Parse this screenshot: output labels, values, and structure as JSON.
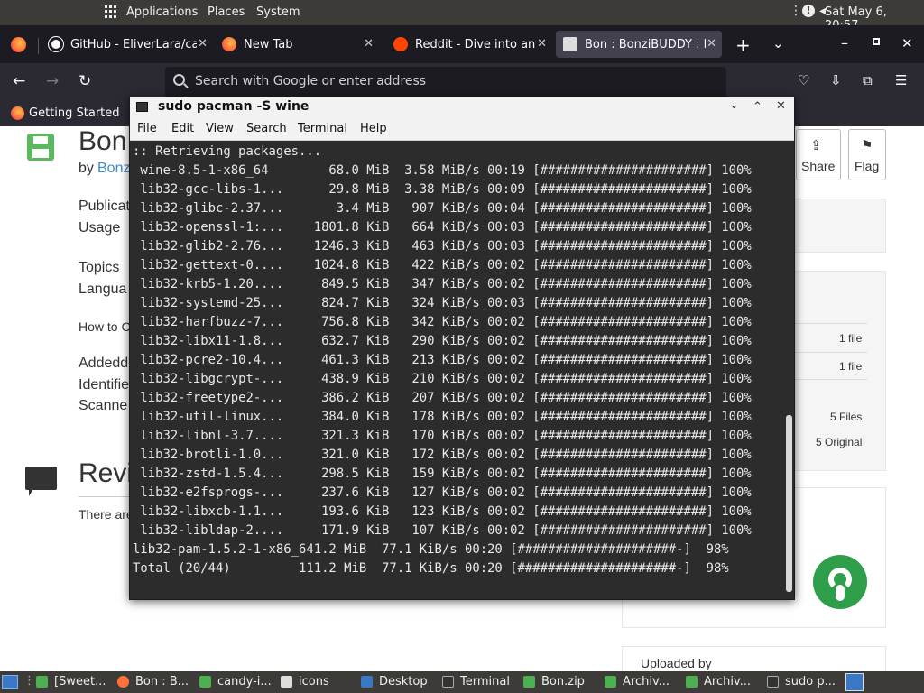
{
  "top_panel": {
    "applications": "Applications",
    "places": "Places",
    "system": "System",
    "clock": "Sat May 6, 20:57"
  },
  "tabs": [
    {
      "label": "GitHub - EliverLara/ca",
      "favicon": "github-icon",
      "color": "#ffffff"
    },
    {
      "label": "New Tab",
      "favicon": "firefox-icon",
      "color": "#ff7139"
    },
    {
      "label": "Reddit - Dive into any",
      "favicon": "reddit-icon",
      "color": "#ff4500"
    },
    {
      "label": "Bon : BonziBUDDY : F",
      "favicon": "archive-icon",
      "color": "#dddddd"
    }
  ],
  "urlbar": {
    "placeholder": "Search with Google or enter address"
  },
  "bookmarks": {
    "getting_started": "Getting Started"
  },
  "webpage": {
    "title": "Bon",
    "by": "by",
    "author": "Bonz",
    "publication": "Publicat",
    "usage": "Usage",
    "topics": "Topics",
    "language": "Langua",
    "howto": "How to C",
    "added": "Addedd",
    "identifier": "Identifie",
    "scanner": "Scanne",
    "reviews": "Revi",
    "there_are": "There are",
    "share": "Share",
    "flag": "Flag",
    "file1": "1 file",
    "file2": "1 file",
    "files5": "5 Files",
    "original5": "5 Original",
    "uploaded_by": "Uploaded by"
  },
  "terminal": {
    "title": "sudo pacman -S wine",
    "menu": [
      "File",
      "Edit",
      "View",
      "Search",
      "Terminal",
      "Help"
    ],
    "header": ":: Retrieving packages...",
    "rows": [
      [
        "wine-8.5-1-x86_64",
        "68.0 MiB",
        "3.58 MiB/s",
        "00:19",
        "[######################]",
        "100%"
      ],
      [
        "lib32-gcc-libs-1...",
        "29.8 MiB",
        "3.38 MiB/s",
        "00:09",
        "[######################]",
        "100%"
      ],
      [
        "lib32-glibc-2.37...",
        "3.4 MiB",
        "907 KiB/s",
        "00:04",
        "[######################]",
        "100%"
      ],
      [
        "lib32-openssl-1:...",
        "1801.8 KiB",
        "664 KiB/s",
        "00:03",
        "[######################]",
        "100%"
      ],
      [
        "lib32-glib2-2.76...",
        "1246.3 KiB",
        "463 KiB/s",
        "00:03",
        "[######################]",
        "100%"
      ],
      [
        "lib32-gettext-0....",
        "1024.8 KiB",
        "422 KiB/s",
        "00:02",
        "[######################]",
        "100%"
      ],
      [
        "lib32-krb5-1.20....",
        "849.5 KiB",
        "347 KiB/s",
        "00:02",
        "[######################]",
        "100%"
      ],
      [
        "lib32-systemd-25...",
        "824.7 KiB",
        "324 KiB/s",
        "00:03",
        "[######################]",
        "100%"
      ],
      [
        "lib32-harfbuzz-7...",
        "756.8 KiB",
        "342 KiB/s",
        "00:02",
        "[######################]",
        "100%"
      ],
      [
        "lib32-libx11-1.8...",
        "632.7 KiB",
        "290 KiB/s",
        "00:02",
        "[######################]",
        "100%"
      ],
      [
        "lib32-pcre2-10.4...",
        "461.3 KiB",
        "213 KiB/s",
        "00:02",
        "[######################]",
        "100%"
      ],
      [
        "lib32-libgcrypt-...",
        "438.9 KiB",
        "210 KiB/s",
        "00:02",
        "[######################]",
        "100%"
      ],
      [
        "lib32-freetype2-...",
        "386.2 KiB",
        "207 KiB/s",
        "00:02",
        "[######################]",
        "100%"
      ],
      [
        "lib32-util-linux...",
        "384.0 KiB",
        "178 KiB/s",
        "00:02",
        "[######################]",
        "100%"
      ],
      [
        "lib32-libnl-3.7....",
        "321.3 KiB",
        "170 KiB/s",
        "00:02",
        "[######################]",
        "100%"
      ],
      [
        "lib32-brotli-1.0...",
        "321.0 KiB",
        "172 KiB/s",
        "00:02",
        "[######################]",
        "100%"
      ],
      [
        "lib32-zstd-1.5.4...",
        "298.5 KiB",
        "159 KiB/s",
        "00:02",
        "[######################]",
        "100%"
      ],
      [
        "lib32-e2fsprogs-...",
        "237.6 KiB",
        "127 KiB/s",
        "00:02",
        "[######################]",
        "100%"
      ],
      [
        "lib32-libxcb-1.1...",
        "193.6 KiB",
        "123 KiB/s",
        "00:02",
        "[######################]",
        "100%"
      ],
      [
        "lib32-libldap-2....",
        "171.9 KiB",
        "107 KiB/s",
        "00:02",
        "[######################]",
        "100%"
      ]
    ],
    "pam_line": "lib32-pam-1.5.2-1-x86_641.2 MiB  77.1 KiB/s 00:20 [#####################-]  98%",
    "total_line": "Total (20/44)         111.2 MiB  77.1 KiB/s 00:20 [#####################-]  98%"
  },
  "taskbar": [
    {
      "label": "[Sweet...",
      "color": "#4caf50"
    },
    {
      "label": "Bon : B...",
      "color": "#ff7139"
    },
    {
      "label": "candy-i...",
      "color": "#4caf50"
    },
    {
      "label": "icons",
      "color": "#dddddd"
    },
    {
      "label": "Desktop",
      "color": "#3a77c4"
    },
    {
      "label": "Terminal",
      "color": "#333333"
    },
    {
      "label": "Bon.zip",
      "color": "#4caf50"
    },
    {
      "label": "Archiv...",
      "color": "#4caf50"
    },
    {
      "label": "Archiv...",
      "color": "#4caf50"
    },
    {
      "label": "sudo p...",
      "color": "#333333"
    }
  ]
}
